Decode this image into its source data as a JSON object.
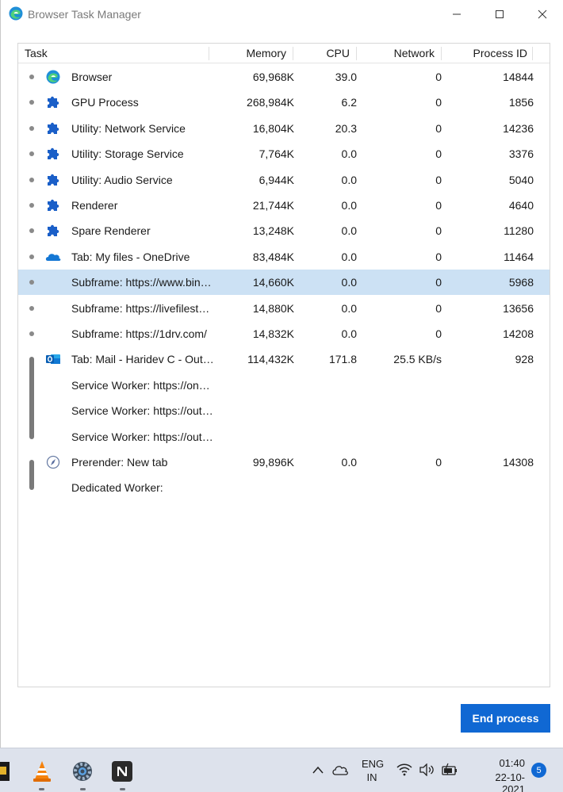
{
  "window": {
    "title": "Browser Task Manager"
  },
  "columns": {
    "task": "Task",
    "memory": "Memory",
    "cpu": "CPU",
    "network": "Network",
    "pid": "Process ID"
  },
  "rows": [
    {
      "task": "Browser",
      "memory": "69,968K",
      "cpu": "39.0",
      "network": "0",
      "pid": "14844",
      "icon": "edge-icon"
    },
    {
      "task": "GPU Process",
      "memory": "268,984K",
      "cpu": "6.2",
      "network": "0",
      "pid": "1856",
      "icon": "puzzle-icon"
    },
    {
      "task": "Utility: Network Service",
      "memory": "16,804K",
      "cpu": "20.3",
      "network": "0",
      "pid": "14236",
      "icon": "puzzle-icon"
    },
    {
      "task": "Utility: Storage Service",
      "memory": "7,764K",
      "cpu": "0.0",
      "network": "0",
      "pid": "3376",
      "icon": "puzzle-icon"
    },
    {
      "task": "Utility: Audio Service",
      "memory": "6,944K",
      "cpu": "0.0",
      "network": "0",
      "pid": "5040",
      "icon": "puzzle-icon"
    },
    {
      "task": "Renderer",
      "memory": "21,744K",
      "cpu": "0.0",
      "network": "0",
      "pid": "4640",
      "icon": "puzzle-icon"
    },
    {
      "task": "Spare Renderer",
      "memory": "13,248K",
      "cpu": "0.0",
      "network": "0",
      "pid": "11280",
      "icon": "puzzle-icon"
    },
    {
      "task": "Tab: My files - OneDrive",
      "memory": "83,484K",
      "cpu": "0.0",
      "network": "0",
      "pid": "11464",
      "icon": "onedrive-icon"
    },
    {
      "task": "Subframe: https://www.bin…",
      "memory": "14,660K",
      "cpu": "0.0",
      "network": "0",
      "pid": "5968",
      "icon": "",
      "selected": true
    },
    {
      "task": "Subframe: https://livefilest…",
      "memory": "14,880K",
      "cpu": "0.0",
      "network": "0",
      "pid": "13656",
      "icon": ""
    },
    {
      "task": "Subframe: https://1drv.com/",
      "memory": "14,832K",
      "cpu": "0.0",
      "network": "0",
      "pid": "14208",
      "icon": ""
    },
    {
      "task": "Tab: Mail - Haridev C - Out…",
      "memory": "114,432K",
      "cpu": "171.8",
      "network": "25.5 KB/s",
      "pid": "928",
      "icon": "outlook-icon"
    },
    {
      "task": "Service Worker: https://on…",
      "memory": "",
      "cpu": "",
      "network": "",
      "pid": "",
      "icon": ""
    },
    {
      "task": "Service Worker: https://out…",
      "memory": "",
      "cpu": "",
      "network": "",
      "pid": "",
      "icon": ""
    },
    {
      "task": "Service Worker: https://out…",
      "memory": "",
      "cpu": "",
      "network": "",
      "pid": "",
      "icon": ""
    },
    {
      "task": "Prerender: New tab",
      "memory": "99,896K",
      "cpu": "0.0",
      "network": "0",
      "pid": "14308",
      "icon": "compass-icon"
    },
    {
      "task": "Dedicated Worker:",
      "memory": "",
      "cpu": "",
      "network": "",
      "pid": "",
      "icon": ""
    }
  ],
  "actions": {
    "end_process": "End process"
  },
  "taskbar": {
    "lang_line1": "ENG",
    "lang_line2": "IN",
    "time": "01:40",
    "date": "22-10-2021",
    "notifications": "5"
  },
  "colors": {
    "accent": "#1068d3",
    "selected_row": "#cce1f4"
  }
}
